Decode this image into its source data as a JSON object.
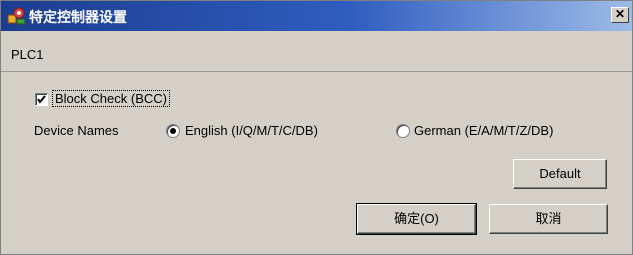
{
  "window": {
    "title": "特定控制器设置",
    "close_glyph": "✕"
  },
  "header": {
    "plc_name": "PLC1"
  },
  "block_check": {
    "label": "Block Check (BCC)",
    "checked": true
  },
  "device_names": {
    "label": "Device Names",
    "options": [
      {
        "label": "English (I/Q/M/T/C/DB)",
        "selected": true
      },
      {
        "label": "German (E/A/M/T/Z/DB)",
        "selected": false
      }
    ]
  },
  "buttons": {
    "default": "Default",
    "ok": "确定(O)",
    "cancel": "取消"
  },
  "icons": {
    "app": "settings-tools-icon"
  },
  "colors": {
    "titlebar_start": "#1c3d8f",
    "titlebar_end": "#9dbbe8",
    "dialog_face": "#d4d0c8"
  }
}
